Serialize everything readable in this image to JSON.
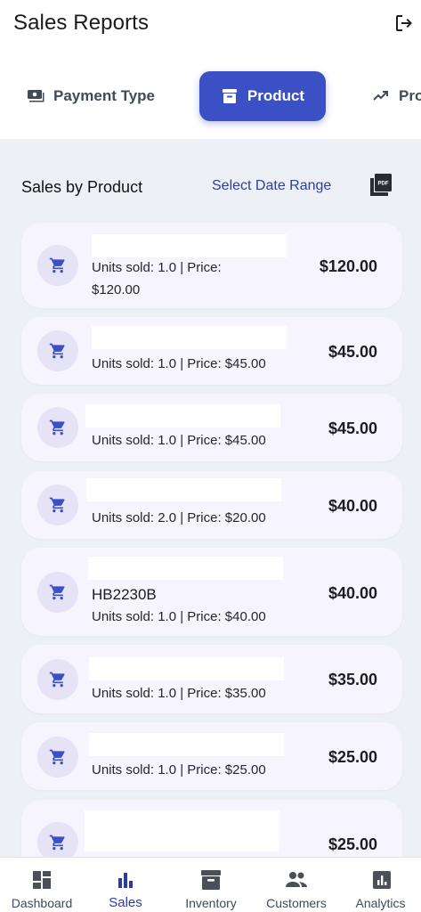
{
  "header": {
    "title": "Sales Reports",
    "logout_icon": "logout-icon"
  },
  "tabs": [
    {
      "label": "Payment Type",
      "icon": "cash-icon",
      "active": false
    },
    {
      "label": "Product",
      "icon": "archive-icon",
      "active": true
    },
    {
      "label": "Pro",
      "icon": "trending-up-icon",
      "active": false
    }
  ],
  "section": {
    "title": "Sales by Product",
    "date_range_label": "Select Date Range",
    "pdf_icon": "pdf-icon"
  },
  "items": [
    {
      "name": "",
      "details_line1": "Units sold: 1.0 | Price:",
      "details_line2": "$120.00",
      "amount": "$120.00"
    },
    {
      "name": "",
      "details_line1": "Units sold: 1.0 | Price: $45.00",
      "details_line2": "",
      "amount": "$45.00"
    },
    {
      "name": "",
      "details_line1": "Units sold: 1.0 | Price: $45.00",
      "details_line2": "",
      "amount": "$45.00"
    },
    {
      "name": "",
      "details_line1": "Units sold: 2.0 | Price: $20.00",
      "details_line2": "",
      "amount": "$40.00"
    },
    {
      "name": "HB2230B",
      "details_line1": "Units sold: 1.0 | Price: $40.00",
      "details_line2": "",
      "amount": "$40.00"
    },
    {
      "name": "",
      "details_line1": "Units sold: 1.0 | Price: $35.00",
      "details_line2": "",
      "amount": "$35.00"
    },
    {
      "name": "",
      "details_line1": "Units sold: 1.0 | Price: $25.00",
      "details_line2": "",
      "amount": "$25.00"
    },
    {
      "name": "",
      "details_line1": "",
      "details_line2": "",
      "amount": "$25.00"
    }
  ],
  "bottom_nav": [
    {
      "label": "Dashboard",
      "icon": "dashboard-icon",
      "active": false
    },
    {
      "label": "Sales",
      "icon": "bar-chart-icon",
      "active": true
    },
    {
      "label": "Inventory",
      "icon": "inventory-icon",
      "active": false
    },
    {
      "label": "Customers",
      "icon": "people-icon",
      "active": false
    },
    {
      "label": "Analytics",
      "icon": "analytics-icon",
      "active": false
    }
  ],
  "colors": {
    "accent": "#3a50c4",
    "card_bg": "#f6f4fc",
    "page_bg": "#edf0f5",
    "link": "#2e3f9a"
  }
}
